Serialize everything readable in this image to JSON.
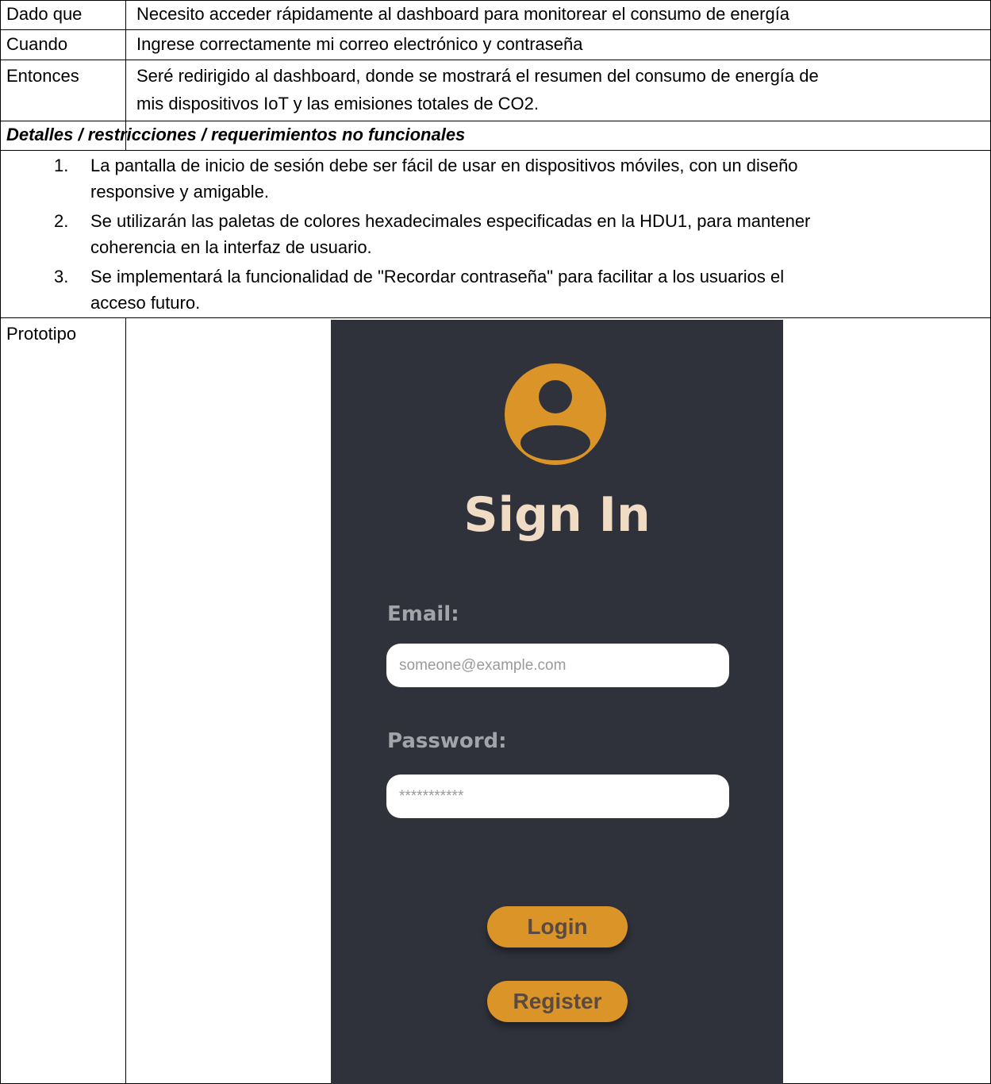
{
  "rows": [
    {
      "label": "Dado que",
      "value": "Necesito acceder rápidamente al dashboard para monitorear el consumo de energía"
    },
    {
      "label": "Cuando",
      "value": "Ingrese correctamente mi correo electrónico y contraseña"
    },
    {
      "label": "Entonces",
      "value_line1": "Seré redirigido al dashboard, donde se mostrará el resumen del consumo de energía de",
      "value_line2": "mis dispositivos IoT y las emisiones totales de CO2."
    }
  ],
  "details": {
    "heading": "Detalles / restricciones / requerimientos no funcionales",
    "items": [
      {
        "num": "1.",
        "line1": "La pantalla de inicio de sesión debe ser fácil de usar en dispositivos móviles, con un diseño",
        "line2": "responsive y amigable."
      },
      {
        "num": "2.",
        "line1": "Se utilizarán las paletas de colores hexadecimales especificadas en la HDU1, para mantener",
        "line2": "coherencia en la interfaz de usuario."
      },
      {
        "num": "3.",
        "line1": "Se implementará la funcionalidad de \"Recordar contraseña\" para facilitar a los usuarios el",
        "line2": "acceso futuro."
      }
    ]
  },
  "prototype": {
    "label": "Prototipo",
    "title": "Sign In",
    "email_label": "Email:",
    "email_placeholder": "someone@example.com",
    "password_label": "Password:",
    "password_placeholder": "***********",
    "login_label": "Login",
    "register_label": "Register",
    "avatar_icon": "user-avatar-icon",
    "colors": {
      "background": "#2f313b",
      "accent": "#db9427",
      "title": "#f0dcc4",
      "label": "#a3a4a8"
    }
  }
}
